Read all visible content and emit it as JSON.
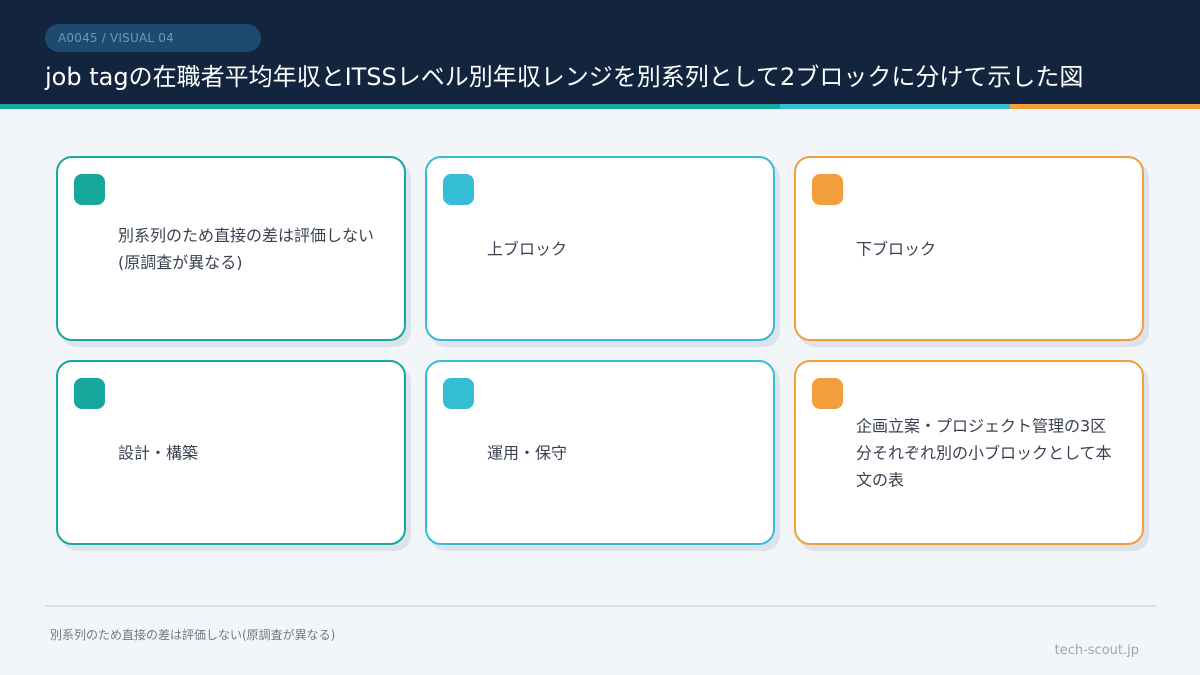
{
  "header": {
    "tag": "A0045 / VISUAL 04",
    "title": "job tagの在職者平均年収とITSSレベル別年収レンジを別系列として2ブロックに分けて示した図"
  },
  "colors": {
    "header_bg": "#13243f",
    "teal": "#16a89c",
    "cyan": "#36bdd6",
    "orange": "#f29e3d"
  },
  "cards": [
    {
      "text": "別系列のため直接の差は評価しない(原調査が異なる)",
      "color": "teal"
    },
    {
      "text": "上ブロック",
      "color": "cyan"
    },
    {
      "text": "下ブロック",
      "color": "orange"
    },
    {
      "text": "設計・構築",
      "color": "teal"
    },
    {
      "text": "運用・保守",
      "color": "cyan"
    },
    {
      "text": "企画立案・プロジェクト管理の3区分それぞれ別の小ブロックとして本文の表",
      "color": "orange"
    }
  ],
  "footer": {
    "note": "別系列のため直接の差は評価しない(原調査が異なる)",
    "brand": "tech-scout.jp"
  }
}
